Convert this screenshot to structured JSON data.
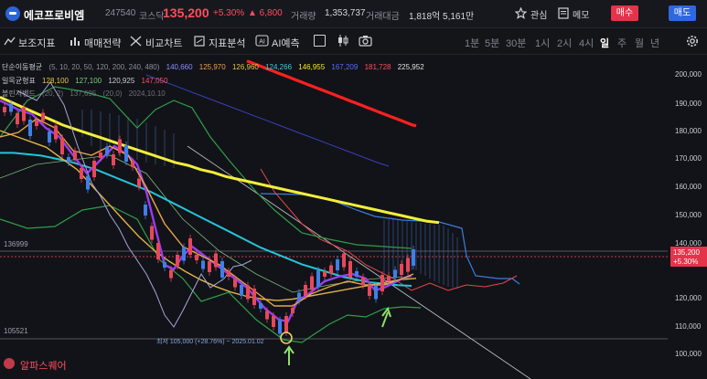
{
  "header": {
    "stock_name": "에코프로비엠",
    "stock_code": "247540",
    "market": "코스닥",
    "price": "135,200",
    "change_pct": "+5.30%",
    "change_amount": "▲ 6,800",
    "volume_label": "거래량",
    "volume": "1,353,737",
    "amount_label": "거래대금",
    "amount": "1,818억 5,161만",
    "watch_label": "관심",
    "memo_label": "메모",
    "buy_label": "매수",
    "sell_label": "매도"
  },
  "toolbar": {
    "indicators": "보조지표",
    "strategy": "매매전략",
    "compare": "비교차트",
    "analysis": "지표분석",
    "ai": "AI예측",
    "timeframes": [
      "1분",
      "5분",
      "30분",
      "1시",
      "2시",
      "4시",
      "일",
      "주",
      "월",
      "년"
    ],
    "active_timeframe": "일"
  },
  "legend": {
    "sma_label": "단순이동평균",
    "sma_params": "(5, 10, 20, 50, 120, 200, 240, 480)",
    "sma_values": [
      "140,660",
      "125,970",
      "126,960",
      "124,266",
      "146,955",
      "167,209",
      "181,728",
      "225,952"
    ],
    "sma_colors": [
      "#8a8fff",
      "#f0a04b",
      "#e6c34a",
      "#3ad1e0",
      "#f5e830",
      "#5a6bff",
      "#ff4d5e",
      "#e0e0e0"
    ],
    "ichimoku_label": "일목균형표",
    "ichimoku_values": [
      "128,100",
      "127,100",
      "120,925",
      "147,050"
    ],
    "ichimoku_colors": [
      "#f0c24b",
      "#7ad07a",
      "#c9ccd3",
      "#ff4d5e"
    ],
    "env_label": "볼린저밴드",
    "env_values": [
      "(20, 2)",
      "137,695",
      "(20,0)",
      "2024,10.10"
    ]
  },
  "price_axis": {
    "ticks": [
      "200,000",
      "190,000",
      "180,000",
      "170,000",
      "160,000",
      "150,000",
      "140,000",
      "130,000",
      "120,000",
      "110,000",
      "100,000"
    ],
    "current_price": "135,200",
    "current_pct": "+5.30%",
    "ref_high": "136999",
    "ref_low": "105521"
  },
  "annotation": {
    "low_note": "최저 105,000 (+28.76%) ~ 2025.01.02"
  },
  "watermark": "알파스퀘어",
  "chart_data": {
    "type": "line",
    "title": "",
    "ylim": [
      95000,
      205000
    ],
    "x": [
      0,
      1,
      2,
      3,
      4,
      5,
      6,
      7,
      8,
      9,
      10,
      11,
      12,
      13,
      14,
      15,
      16,
      17,
      18,
      19,
      20,
      21,
      22,
      23,
      24,
      25,
      26,
      27,
      28,
      29,
      30,
      31,
      32,
      33,
      34,
      35,
      36,
      37,
      38,
      39,
      40,
      41,
      42,
      43,
      44,
      45,
      46,
      47,
      48,
      49,
      50,
      51,
      52,
      53,
      54,
      55,
      56,
      57,
      58,
      59,
      60,
      61,
      62,
      63,
      64,
      65,
      66,
      67,
      68,
      69
    ],
    "series": [
      {
        "name": "SMA 240",
        "color": "#ff4d5e",
        "values": [
          205000,
          204500,
          204000,
          203500,
          203000,
          202500,
          202000,
          201500,
          201000,
          200500,
          200000,
          199500,
          199000,
          198500,
          198000,
          197500,
          197000,
          196500,
          196000,
          195500,
          195000,
          194500,
          194000,
          193500,
          193000,
          192500,
          192000,
          191500,
          191000,
          190500,
          190000,
          189500,
          189000,
          188500,
          188000,
          187500,
          187000,
          186500,
          186000,
          185500,
          185000,
          184500,
          184000,
          183500,
          183000,
          182500,
          182000,
          181728,
          null,
          null,
          null,
          null,
          null,
          null,
          null,
          null,
          null,
          null,
          null,
          null,
          null,
          null,
          null,
          null,
          null,
          null,
          null,
          null,
          null,
          null
        ]
      },
      {
        "name": "SMA 200",
        "color": "#5a6bff",
        "values": [
          null,
          null,
          null,
          null,
          null,
          null,
          null,
          null,
          null,
          null,
          200000,
          198500,
          197000,
          195500,
          194000,
          192500,
          191000,
          189500,
          188000,
          186500,
          185000,
          183500,
          182000,
          180500,
          179000,
          177500,
          176000,
          174500,
          173000,
          171500,
          170000,
          168500,
          167209,
          null,
          null,
          null,
          null,
          null,
          null,
          null,
          null,
          null,
          null,
          null,
          null,
          null,
          null,
          null,
          null,
          null,
          null,
          null,
          null,
          null,
          null,
          null,
          null,
          null,
          null,
          null,
          null,
          null,
          null,
          null,
          null,
          null,
          null,
          null,
          null,
          null
        ]
      },
      {
        "name": "SMA 120",
        "color": "#f5e830",
        "values": [
          192000,
          190000,
          188000,
          186000,
          184000,
          182000,
          180500,
          179000,
          177500,
          176000,
          174500,
          173000,
          171500,
          170000,
          168500,
          167500,
          166000,
          165000,
          163500,
          162500,
          161500,
          160500,
          159500,
          158500,
          157500,
          156500,
          155500,
          154500,
          153500,
          152500,
          151500,
          150500,
          149500,
          148500,
          147500,
          146955,
          null,
          null,
          null,
          null,
          null,
          null,
          null,
          null,
          null,
          null,
          null,
          null,
          null,
          null,
          null,
          null,
          null,
          null,
          null,
          null,
          null,
          null,
          null,
          null,
          null,
          null,
          null,
          null,
          null,
          null,
          null,
          null,
          null,
          null
        ]
      },
      {
        "name": "SMA 50",
        "color": "#3ad1e0",
        "values": [
          172000,
          172000,
          171500,
          171000,
          170000,
          169000,
          167500,
          166000,
          164000,
          162000,
          160000,
          158000,
          155500,
          153000,
          150500,
          148000,
          145500,
          143000,
          140500,
          138000,
          136000,
          134000,
          132000,
          130500,
          129000,
          127500,
          126500,
          125500,
          125000,
          124500,
          124266,
          null,
          null,
          null,
          null,
          null,
          null,
          null,
          null,
          null,
          null,
          null,
          null,
          null,
          null,
          null,
          null,
          null,
          null,
          null,
          null,
          null,
          null,
          null,
          null,
          null,
          null,
          null,
          null,
          null,
          null,
          null,
          null,
          null,
          null,
          null,
          null,
          null,
          null,
          null
        ]
      },
      {
        "name": "SMA 20",
        "color": "#e6c34a",
        "values": [
          180000,
          178000,
          176000,
          174000,
          170000,
          166000,
          160000,
          154000,
          148000,
          142000,
          137000,
          133000,
          129500,
          126500,
          124000,
          122000,
          120500,
          119500,
          119000,
          119500,
          120500,
          121500,
          122500,
          123500,
          124500,
          125500,
          126500,
          126960,
          null,
          null,
          null,
          null,
          null,
          null,
          null,
          null,
          null,
          null,
          null,
          null,
          null,
          null,
          null,
          null,
          null,
          null,
          null,
          null,
          null,
          null,
          null,
          null,
          null,
          null,
          null,
          null,
          null,
          null,
          null,
          null,
          null,
          null,
          null,
          null,
          null,
          null,
          null,
          null,
          null,
          null
        ]
      }
    ]
  }
}
